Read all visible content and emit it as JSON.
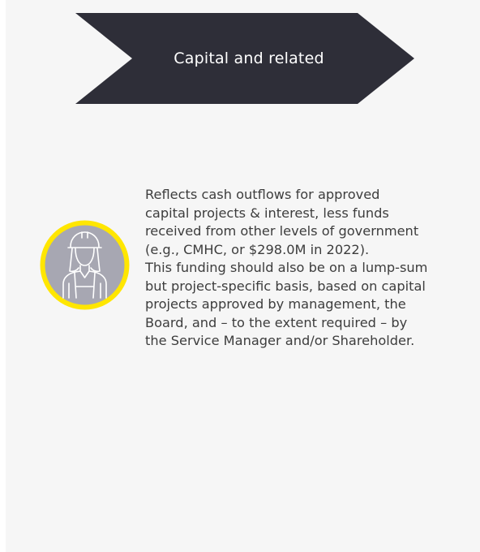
{
  "header": {
    "label": "Capital and related",
    "fill_color": "#2e2e38",
    "text_color": "#ffffff"
  },
  "icon": {
    "name": "construction-worker-icon",
    "ring_color": "#ffe600",
    "fill_color": "#a7a7b2",
    "line_color": "#ffffff"
  },
  "description": {
    "text": "Reflects cash outflows for approved\ncapital projects & interest, less funds\nreceived from other levels of government\n(e.g., CMHC, or $298.0M in 2022).\nThis funding should also be on a lump-sum\nbut project-specific basis, based on capital\nprojects approved by management, the\nBoard, and – to the extent required – by\nthe Service Manager and/or Shareholder."
  }
}
